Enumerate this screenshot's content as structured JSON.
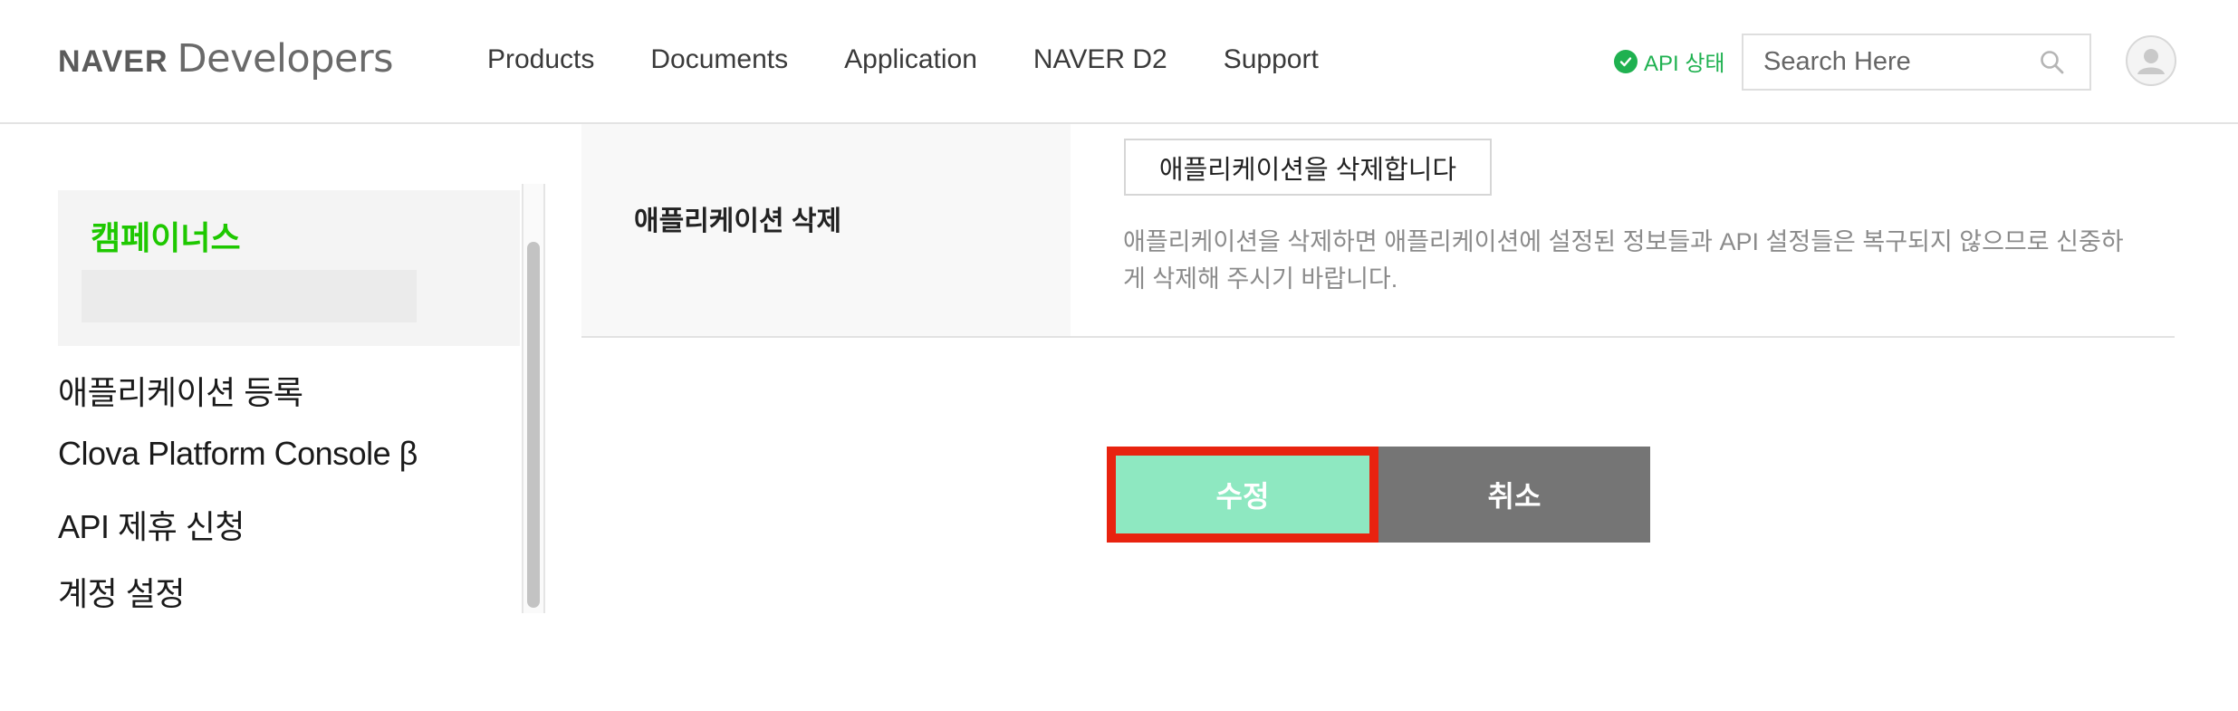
{
  "header": {
    "logo_brand": "NAVER",
    "logo_product": "Developers",
    "nav": [
      "Products",
      "Documents",
      "Application",
      "NAVER D2",
      "Support"
    ],
    "api_status_label": "API 상태",
    "search_placeholder": "Search Here"
  },
  "sidebar": {
    "active_title": "캠페이너스",
    "items": [
      "애플리케이션 등록",
      "Clova Platform Console β",
      "API 제휴 신청",
      "계정 설정"
    ]
  },
  "content": {
    "delete_row_label": "애플리케이션 삭제",
    "delete_button": "애플리케이션을 삭제합니다",
    "delete_desc_line1": "애플리케이션을 삭제하면 애플리케이션에 설정된 정보들과 API 설정들은 복구되지 않으므로 신중하",
    "delete_desc_line2": "게 삭제해 주시기 바랍니다."
  },
  "actions": {
    "save": "수정",
    "cancel": "취소"
  },
  "colors": {
    "brand_green": "#1ec800",
    "status_green": "#1fb150",
    "save_bg": "#8ee8c1",
    "highlight_border": "#e8230f",
    "cancel_bg": "#757575"
  },
  "icons": {
    "status": "check-circle-icon",
    "search": "search-icon",
    "avatar": "user-avatar-icon"
  }
}
